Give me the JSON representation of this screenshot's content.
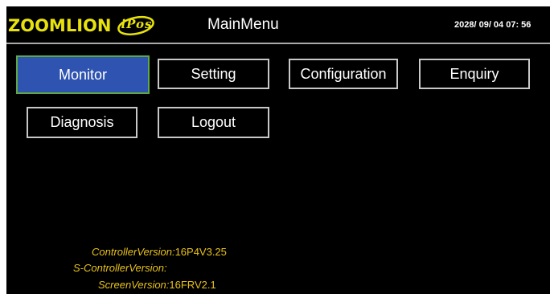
{
  "header": {
    "logo_text": "ZOOMLION",
    "logo_sub": "iPos",
    "title": "MainMenu",
    "datetime": "2028/ 09/  04 07:  56"
  },
  "menu": {
    "monitor": "Monitor",
    "setting": "Setting",
    "configuration": "Configuration",
    "enquiry": "Enquiry",
    "diagnosis": "Diagnosis",
    "logout": "Logout"
  },
  "versions": {
    "controller_label": "ControllerVersion:",
    "controller_value": "16P4V3.25",
    "s_controller_label": "S-ControllerVersion:",
    "s_controller_value": "",
    "screen_label": "ScreenVersion:",
    "screen_value": "16FRV2.1"
  },
  "colors": {
    "background": "#000000",
    "logo": "#e8e20c",
    "active_button": "#2f53b0",
    "active_border": "#5fa846",
    "button_border": "#c8c8c8",
    "version_text": "#e8c21a"
  }
}
